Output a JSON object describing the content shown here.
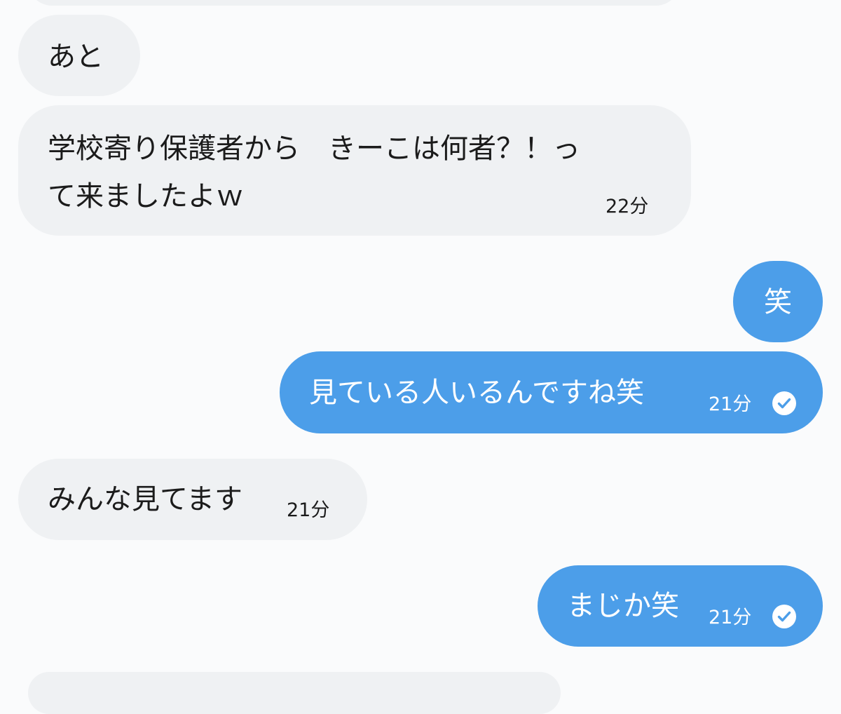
{
  "conversation": {
    "messages": [
      {
        "direction": "incoming",
        "text": "",
        "time": ""
      },
      {
        "direction": "incoming",
        "text": "あと",
        "time": ""
      },
      {
        "direction": "incoming",
        "text_line1": "学校寄り保護者から　きーこは何者？！っ",
        "text_line2": "て来ましたよｗ",
        "time": "22分"
      },
      {
        "direction": "outgoing",
        "text": "笑",
        "time": ""
      },
      {
        "direction": "outgoing",
        "text": "見ている人いるんですね笑",
        "time": "21分",
        "status_icon": "read-check-icon"
      },
      {
        "direction": "incoming",
        "text": "みんな見てます",
        "time": "21分"
      },
      {
        "direction": "outgoing",
        "text": "まじか笑",
        "time": "21分",
        "status_icon": "read-check-icon"
      },
      {
        "direction": "incoming",
        "text": "",
        "time": ""
      }
    ]
  },
  "colors": {
    "background": "#fafbfc",
    "incoming_bubble": "#eff1f3",
    "outgoing_bubble": "#4c9ee9",
    "incoming_text": "#1b1b1b",
    "outgoing_text": "#ffffff"
  }
}
